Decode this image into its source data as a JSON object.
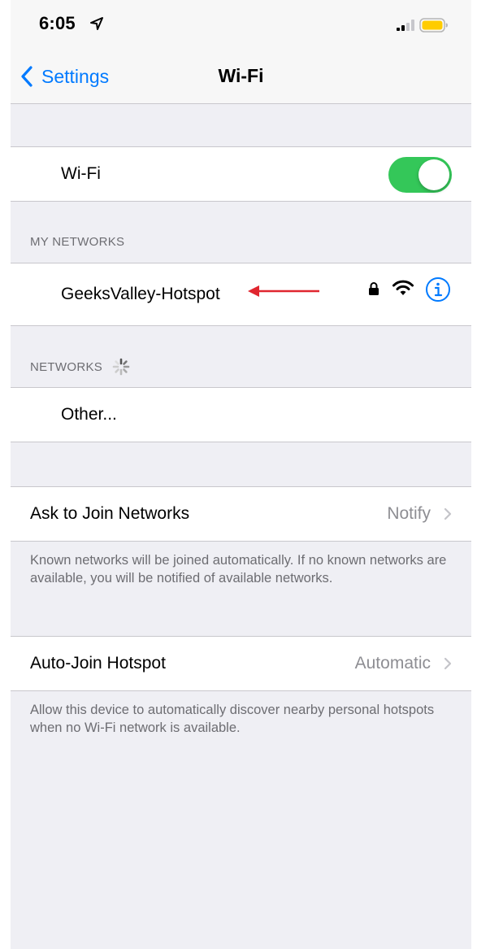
{
  "status_bar": {
    "time": "6:05"
  },
  "nav": {
    "back_label": "Settings",
    "title": "Wi-Fi"
  },
  "wifi_toggle": {
    "label": "Wi-Fi",
    "on": true
  },
  "my_networks": {
    "header": "MY NETWORKS",
    "items": [
      {
        "name": "GeeksValley-Hotspot",
        "locked": true
      }
    ]
  },
  "networks": {
    "header": "NETWORKS",
    "other_label": "Other..."
  },
  "ask_to_join": {
    "label": "Ask to Join Networks",
    "value": "Notify",
    "footer": "Known networks will be joined automatically. If no known networks are available, you will be notified of available networks."
  },
  "auto_join": {
    "label": "Auto-Join Hotspot",
    "value": "Automatic",
    "footer": "Allow this device to automatically discover nearby personal hotspots when no Wi-Fi network is available."
  },
  "colors": {
    "accent": "#007aff",
    "toggle_on": "#34c759",
    "arrow": "#e0262f",
    "battery": "#ffcc00"
  },
  "icons": [
    "location-arrow-icon",
    "signal-icon",
    "battery-icon",
    "chevron-left-icon",
    "lock-icon",
    "wifi-icon",
    "info-icon",
    "chevron-right-icon",
    "spinner-icon",
    "red-arrow-icon"
  ]
}
